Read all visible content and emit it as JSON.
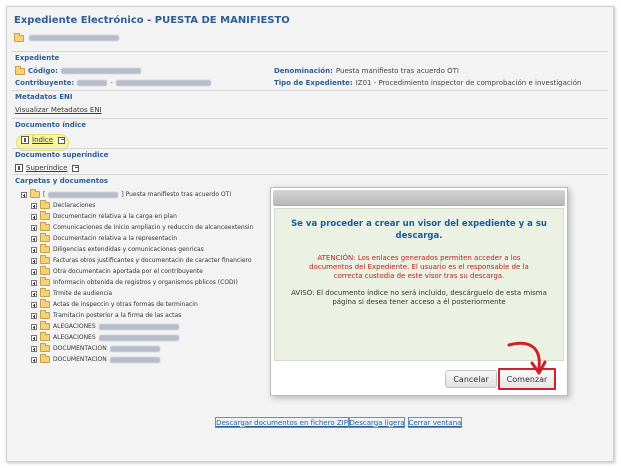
{
  "window": {
    "title": "Expediente Electrónico - PUESTA DE MANIFIESTO"
  },
  "expediente": {
    "section_title": "Expediente",
    "codigo_label": "Código:",
    "contribuyente_label": "Contribuyente:",
    "contribuyente_sep": "-",
    "denominacion_label": "Denominación:",
    "denominacion_value": "Puesta manifiesto tras acuerdo OTI",
    "tipo_label": "Tipo de Expediente:",
    "tipo_value": "IZ01 - Procedimiento inspector de comprobación e investigación"
  },
  "metadatos": {
    "section_title": "Metadatos ENI",
    "link": "Visualizar Metadatos ENI"
  },
  "documento_indice": {
    "section_title": "Documento índice",
    "link": "Índice"
  },
  "documento_superindice": {
    "section_title": "Documento superíndice",
    "link": "Superíndice"
  },
  "carpetas": {
    "section_title": "Carpetas y documentos",
    "root_open": "[",
    "root_label": "] Puesta manifiesto tras acuerdo OTI",
    "items": [
      "Declaraciones",
      "Documentacin relativa a la carga en plan",
      "Comunicaciones de inicio ampliacin y reduccin de alcanceextensin",
      "Documentacin relativa a la representacin",
      "Diligencias extendidas y comunicaciones genricas",
      "Facturas otros justificantes y documentacin de caracter financiero",
      "Otra documentacin aportada por el contribuyente",
      "Informacin obtenida de registros y organismos pblicos (CODI)",
      "Trmite de audiencia",
      "Actas de inspeccin y otras formas de terminacin",
      "Tramitacin posterior a la firma de las actas",
      "ALEGACIONES",
      "ALEGACIONES",
      "DOCUMENTACION",
      "DOCUMENTACION"
    ]
  },
  "modal": {
    "title": "Se va proceder a crear un visor del expediente y a su descarga.",
    "warning": "ATENCIÓN: Los enlaces generados permiten acceder a los documentos del Expediente. El usuario es el responsable de la correcta custodia de este visor tras su descarga.",
    "note": "AVISO: El documento índice no será incluido, descárguelo de esta misma página si desea tener acceso a él posteriormente",
    "cancel_label": "Cancelar",
    "start_label": "Comenzar"
  },
  "footer": {
    "download_zip": "Descargar documentos en fichero ZIP",
    "download_light": "Descarga ligera",
    "close_window": "Cerrar ventana"
  },
  "colors": {
    "accent": "#2d5e93",
    "highlight": "#f6f59a",
    "modal_bg": "#ebf2e4",
    "warning_text": "#b2251e",
    "annotation_red": "#d0202a"
  }
}
